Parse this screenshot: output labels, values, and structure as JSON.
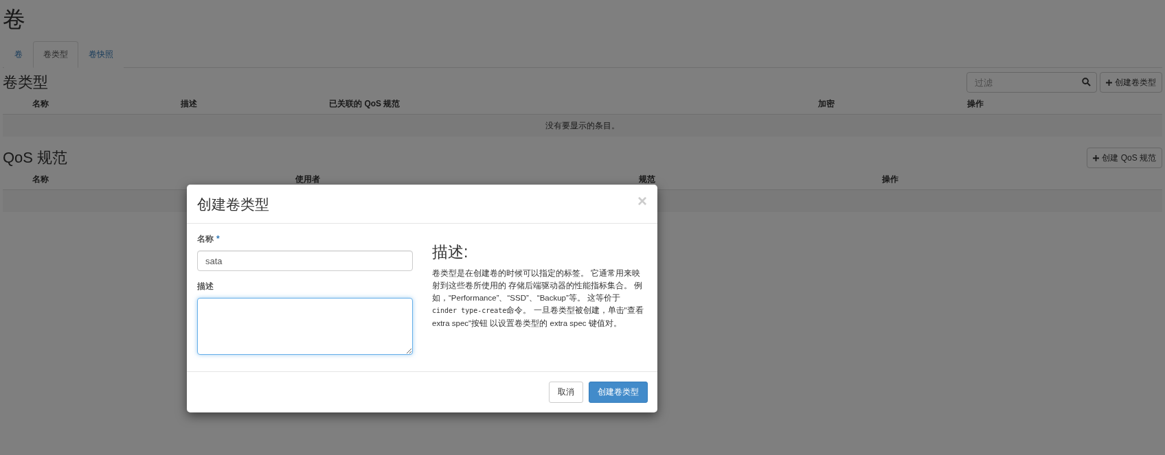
{
  "page_title": "卷",
  "tabs": [
    {
      "label": "卷",
      "selected": false
    },
    {
      "label": "卷类型",
      "selected": true
    },
    {
      "label": "卷快照",
      "selected": false
    }
  ],
  "volume_types": {
    "title": "卷类型",
    "filter": {
      "placeholder": "过滤"
    },
    "create_button": "创建卷类型",
    "columns": [
      {
        "label": "名称"
      },
      {
        "label": "描述"
      },
      {
        "label": "已关联的 QoS 规范"
      },
      {
        "label": "加密"
      },
      {
        "label": "操作"
      }
    ],
    "empty_message": "没有要显示的条目。"
  },
  "qos_specs": {
    "title": "QoS 规范",
    "create_button": "创建 QoS 规范",
    "columns": [
      {
        "label": "名称"
      },
      {
        "label": "使用者"
      },
      {
        "label": "规范"
      },
      {
        "label": "操作"
      }
    ]
  },
  "modal": {
    "title": "创建卷类型",
    "close": "×",
    "fields": [
      {
        "kind": "input",
        "label": "名称",
        "required_mark": "*",
        "value": "sata",
        "focused": false
      },
      {
        "kind": "textarea",
        "label": "描述",
        "focused": true
      }
    ],
    "help_title": "描述:",
    "help_parts": [
      {
        "kind": "text",
        "text": "卷类型是在创建卷的时候可以指定的标签。 它通常用来映射到这些卷所使用的 存储后端驱动器的性能指标集合。 例如，“Performance”、“SSD”、“Backup”等。 这等价于 "
      },
      {
        "kind": "code",
        "text": "cinder type-create"
      },
      {
        "kind": "text",
        "text": "命令。 一旦卷类型被创建，单击\"查看 extra spec\"按钮 以设置卷类型的 extra spec 键值对。"
      }
    ],
    "buttons": [
      {
        "label": "取消",
        "kind": "default"
      },
      {
        "label": "创建卷类型",
        "kind": "primary"
      }
    ]
  }
}
